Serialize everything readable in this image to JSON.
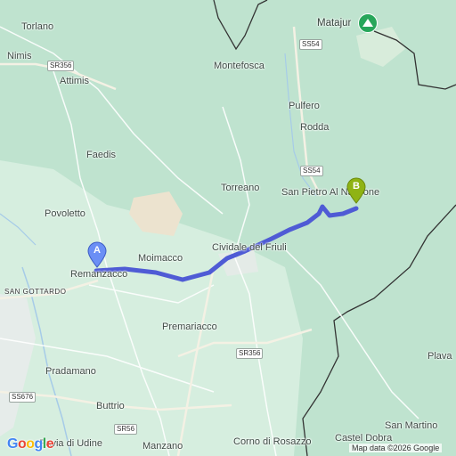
{
  "map": {
    "places": {
      "torlano": "Torlano",
      "nimis": "Nimis",
      "attimis": "Attimis",
      "faedis": "Faedis",
      "povoletto": "Povoletto",
      "remanzacco": "Remanzacco",
      "san_gottardo": "SAN GOTTARDO",
      "moimacco": "Moimacco",
      "cividale": "Cividale del Friuli",
      "torreano": "Torreano",
      "san_pietro": "San Pietro Al Natisone",
      "montefosca": "Montefosca",
      "pulfero": "Pulfero",
      "rodda": "Rodda",
      "matajur": "Matajur",
      "premariacco": "Premariacco",
      "pradamano": "Pradamano",
      "buttrio": "Buttrio",
      "pavia": "Pavia di Udine",
      "manzano": "Manzano",
      "corno": "Corno di Rosazzo",
      "san_martino": "San Martino",
      "castel_dobra": "Castel Dobra",
      "plava": "Plava"
    },
    "roads": {
      "sr356_a": "SR356",
      "ss54_a": "SS54",
      "ss54_b": "SS54",
      "sr356_b": "SR356",
      "ss676": "SS676",
      "sr56": "SR56"
    },
    "markers": {
      "start": "A",
      "end": "B"
    },
    "colors": {
      "route": "#4f5bd5",
      "marker_start": "#6b8ff5",
      "marker_end": "#8fb314"
    },
    "google_logo": "Google",
    "attribution": "Map data ©2026 Google"
  }
}
